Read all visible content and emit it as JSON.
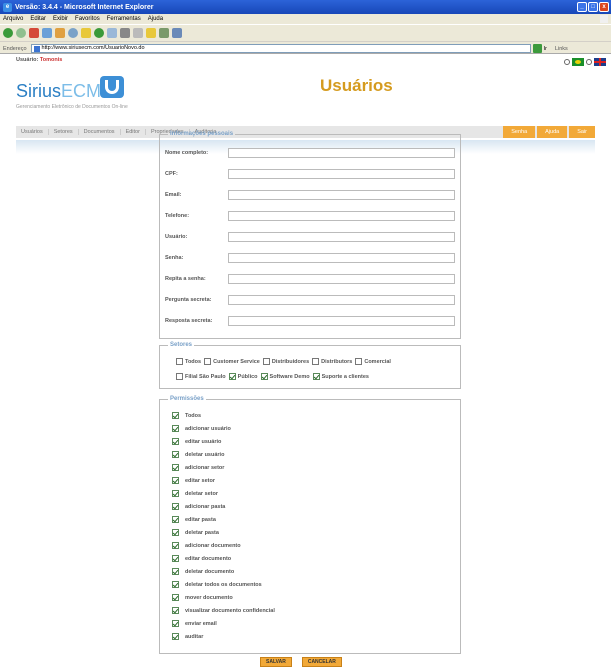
{
  "window": {
    "title": "Versão: 3.4.4 - Microsoft Internet Explorer"
  },
  "menu": [
    "Arquivo",
    "Editar",
    "Exibir",
    "Favoritos",
    "Ferramentas",
    "Ajuda"
  ],
  "address": {
    "label": "Endereço",
    "url": "http://www.siriusecm.com/UsuarioNovo.do",
    "go": "Ir",
    "links": "Links"
  },
  "app": {
    "user_label": "Usuário:",
    "user_name": "Tomonis",
    "logo_text": "Sirius",
    "logo_ecm": "ECM",
    "logo_tm": "™",
    "tagline": "Gerenciamento Eletrônico de Documentos On-line",
    "page_title": "Usuários"
  },
  "nav": {
    "left": [
      "Usuários",
      "Setores",
      "Documentos",
      "Editor",
      "Propriedades",
      "Auditoria"
    ],
    "right": [
      "Senha",
      "Ajuda",
      "Sair"
    ]
  },
  "personal": {
    "legend": "Informações pessoais",
    "fields": [
      {
        "label": "Nome completo:",
        "value": ""
      },
      {
        "label": "CPF:",
        "value": ""
      },
      {
        "label": "Email:",
        "value": ""
      },
      {
        "label": "Telefone:",
        "value": ""
      },
      {
        "label": "Usuário:",
        "value": ""
      },
      {
        "label": "Senha:",
        "value": ""
      },
      {
        "label": "Repita a senha:",
        "value": ""
      },
      {
        "label": "Pergunta secreta:",
        "value": ""
      },
      {
        "label": "Resposta secreta:",
        "value": ""
      }
    ]
  },
  "setores": {
    "legend": "Setores",
    "row1": [
      {
        "label": "Todos",
        "checked": false
      },
      {
        "label": "Customer Service",
        "checked": false
      },
      {
        "label": "Distribuidores",
        "checked": false
      },
      {
        "label": "Distributors",
        "checked": false
      },
      {
        "label": "Comercial",
        "checked": false
      }
    ],
    "row2": [
      {
        "label": "Filial São Paulo",
        "checked": false
      },
      {
        "label": "Público",
        "checked": true
      },
      {
        "label": "Software Demo",
        "checked": true
      },
      {
        "label": "Suporte a clientes",
        "checked": true
      }
    ]
  },
  "permissions": {
    "legend": "Permissões",
    "items": [
      {
        "label": "Todos",
        "checked": true
      },
      {
        "label": "adicionar usuário",
        "checked": true
      },
      {
        "label": "editar usuário",
        "checked": true
      },
      {
        "label": "deletar usuário",
        "checked": true
      },
      {
        "label": "adicionar setor",
        "checked": true
      },
      {
        "label": "editar setor",
        "checked": true
      },
      {
        "label": "deletar setor",
        "checked": true
      },
      {
        "label": "adicionar pasta",
        "checked": true
      },
      {
        "label": "editar pasta",
        "checked": true
      },
      {
        "label": "deletar pasta",
        "checked": true
      },
      {
        "label": "adicionar documento",
        "checked": true
      },
      {
        "label": "editar documento",
        "checked": true
      },
      {
        "label": "deletar documento",
        "checked": true
      },
      {
        "label": "deletar todos os documentos",
        "checked": true
      },
      {
        "label": "mover documento",
        "checked": true
      },
      {
        "label": "visualizar documento confidencial",
        "checked": true
      },
      {
        "label": "enviar email",
        "checked": true
      },
      {
        "label": "auditar",
        "checked": true
      }
    ]
  },
  "buttons": {
    "save": "SALVAR",
    "cancel": "CANCELAR"
  }
}
